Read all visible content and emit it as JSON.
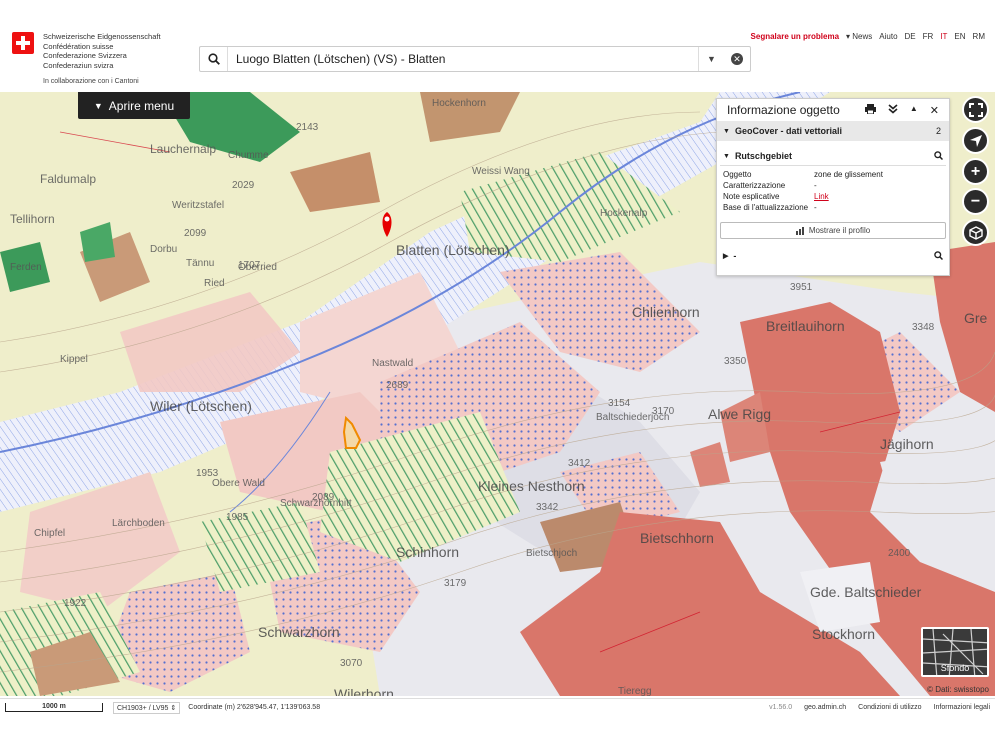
{
  "header": {
    "names": [
      "Schweizerische Eidgenossenschaft",
      "Confédération suisse",
      "Confederazione Svizzera",
      "Confederaziun svizra"
    ],
    "cantons": "In collaborazione con i Cantoni",
    "search_value": "Luogo Blatten (Lötschen) (VS) - Blatten",
    "nav": {
      "report": "Segnalare un problema",
      "news": "News",
      "help": "Aiuto",
      "langs": [
        "DE",
        "FR",
        "IT",
        "EN",
        "RM"
      ],
      "active_lang": "IT"
    }
  },
  "menu": {
    "open_label": "Aprire menu"
  },
  "panel": {
    "title": "Informazione oggetto",
    "layer": "GeoCover - dati vettoriali",
    "layer_count": "2",
    "feature": "Rutschgebiet",
    "attributes": [
      {
        "key": "Oggetto",
        "value": "zone de glissement"
      },
      {
        "key": "Caratterizzazione",
        "value": "-"
      },
      {
        "key": "Note esplicative",
        "value": "Link"
      },
      {
        "key": "Base di l'attualizzazione",
        "value": "-"
      }
    ],
    "profile_button": "Mostrare il profilo",
    "feature2": "-"
  },
  "map": {
    "labels": [
      "Blatten (Lötschen)",
      "Wiler (Lötschen)",
      "Alwe Rigg",
      "Bietschhorn",
      "Breitlauihorn",
      "Chlienhorn",
      "Kleines Nesthorn",
      "Schinhorn",
      "Schwarzhorn",
      "Gde. Baltschieder",
      "Stockhorn",
      "Jägihorn",
      "Wilerhorn",
      "Tieregg",
      "Tellihorn",
      "Lauchernalp",
      "Faldumalp",
      "Nastwald",
      "Chumme",
      "Weritzstafel",
      "Ried",
      "Oberried",
      "Tännu",
      "Dorbu",
      "Baltschiederjoch",
      "Bietschjoch",
      "Gre",
      "Hockenalp",
      "Ferden",
      "Kippel",
      "Lärchboden",
      "Hockenhorn",
      "Weissi Wang",
      "Obere Wald",
      "Chipfel",
      "Schwarzhornhitt"
    ],
    "spot_heights": [
      "2143",
      "2099",
      "2029",
      "1707",
      "1953",
      "1985",
      "2089",
      "3154",
      "3170",
      "3350",
      "3412",
      "3342",
      "3179",
      "3070",
      "2400",
      "1922",
      "3348",
      "3951",
      "2689"
    ]
  },
  "basemap": {
    "label": "Sfondo"
  },
  "copyright": "© Dati: swisstopo",
  "footer": {
    "scale": "1000 m",
    "crs": "CH1903+ / LV95",
    "coordinates": "Coordinate (m) 2'628'945.47, 1'139'063.58",
    "version": "v1.56.0",
    "site": "geo.admin.ch",
    "terms": "Condizioni di utilizzo",
    "legal": "Informazioni legali"
  },
  "colors": {
    "accent": "#d0021b",
    "rock_red": "#d9766a",
    "landslide_pink": "#f2c9c4",
    "moraine_yellow": "#eeeec8",
    "forest_green": "#3c9a5a",
    "glacier": "#e9e9ee",
    "water_blue": "#7c97e0"
  }
}
